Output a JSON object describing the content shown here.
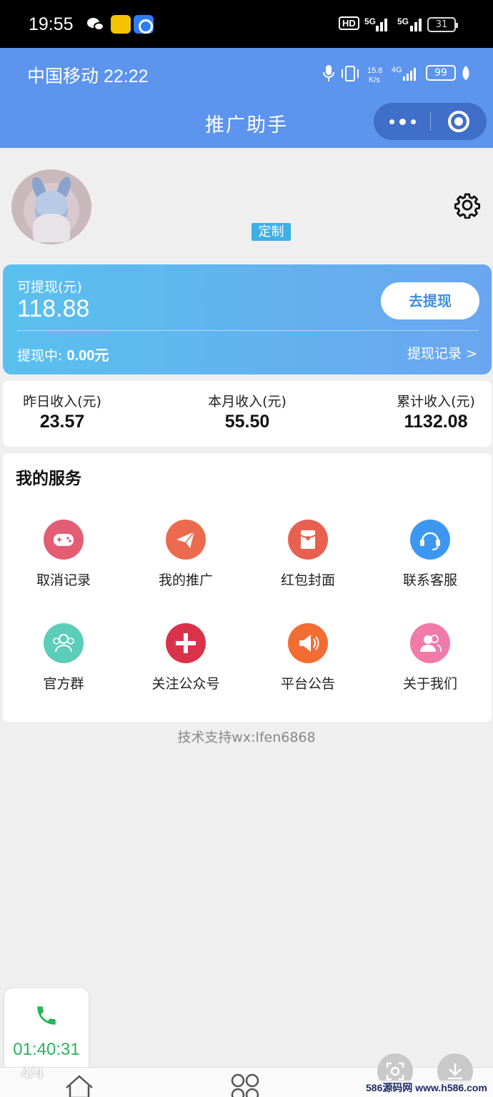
{
  "os_status": {
    "time": "19:55",
    "hd": "HD",
    "net1": "5G",
    "net2": "5G",
    "battery": "31"
  },
  "inner_status": {
    "carrier_time": "中国移动 22:22",
    "speed": "15.8 K/s",
    "net": "4G",
    "battery": "99"
  },
  "header": {
    "title": "推广助手"
  },
  "profile": {
    "badge": "定制"
  },
  "withdraw": {
    "label": "可提现(元)",
    "amount": "118.88",
    "button": "去提现",
    "pending_label": "提现中:",
    "pending_amount": "0.00元",
    "record_link": "提现记录 >"
  },
  "stats": [
    {
      "label": "昨日收入(元)",
      "value": "23.57"
    },
    {
      "label": "本月收入(元)",
      "value": "55.50"
    },
    {
      "label": "累计收入(元)",
      "value": "1132.08"
    }
  ],
  "services": {
    "title": "我的服务",
    "items": [
      {
        "label": "取消记录",
        "icon": "gamepad-icon",
        "color": "#e35d74"
      },
      {
        "label": "我的推广",
        "icon": "paper-plane-icon",
        "color": "#ec6a4e"
      },
      {
        "label": "红包封面",
        "icon": "red-envelope-icon",
        "color": "#e8604f"
      },
      {
        "label": "联系客服",
        "icon": "headset-icon",
        "color": "#3d97f0"
      },
      {
        "label": "官方群",
        "icon": "group-icon",
        "color": "#5ccdb8"
      },
      {
        "label": "关注公众号",
        "icon": "plus-icon",
        "color": "#d9334c"
      },
      {
        "label": "平台公告",
        "icon": "speaker-icon",
        "color": "#f36d32"
      },
      {
        "label": "关于我们",
        "icon": "people-icon",
        "color": "#f07aa8"
      }
    ]
  },
  "support_text": "技术支持wx:lfen6868",
  "call": {
    "duration": "01:40:31"
  },
  "page_indicator": "4/4",
  "watermark": "586源码网 www.h586.com"
}
